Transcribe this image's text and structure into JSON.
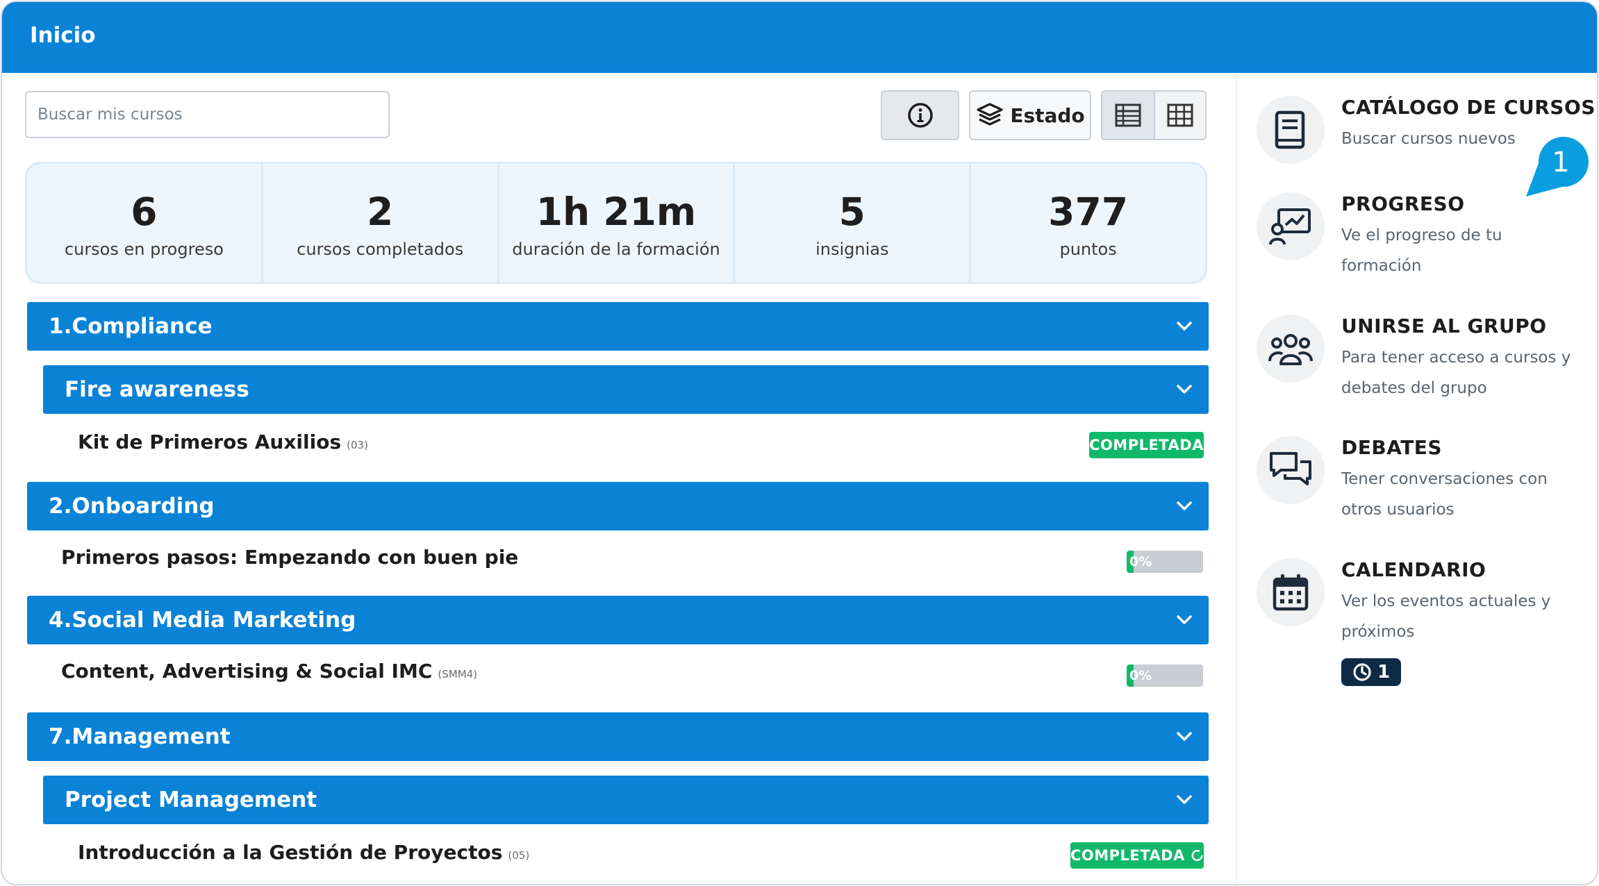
{
  "header": {
    "title": "Inicio"
  },
  "search": {
    "placeholder": "Buscar mis cursos"
  },
  "toolbar": {
    "info_icon": "info-circle-icon",
    "estado_label": "Estado",
    "estado_icon": "layers-icon",
    "view_list_icon": "table-list-icon",
    "view_grid_icon": "grid-icon"
  },
  "stats": [
    {
      "value": "6",
      "label": "cursos en progreso"
    },
    {
      "value": "2",
      "label": "cursos completados"
    },
    {
      "value": "1h 21m",
      "label": "duración de la formación"
    },
    {
      "value": "5",
      "label": "insignias"
    },
    {
      "value": "377",
      "label": "puntos"
    }
  ],
  "categories": [
    {
      "title": "1.Compliance",
      "subcategory": "Fire awareness",
      "course": {
        "name": "Kit de Primeros Auxilios",
        "code": "(03)",
        "status": "COMPLETADA"
      }
    },
    {
      "title": "2.Onboarding",
      "course": {
        "name": "Primeros pasos: Empezando con buen pie",
        "progress": 0,
        "progress_label": "0%"
      }
    },
    {
      "title": "4.Social Media Marketing",
      "course": {
        "name": "Content, Advertising & Social IMC",
        "code": "(SMM4)",
        "progress": 0,
        "progress_label": "0%"
      }
    },
    {
      "title": "7.Management",
      "subcategory": "Project Management",
      "course": {
        "name": "Introducción a la Gestión de Proyectos",
        "code": "(05)",
        "status": "COMPLETADA",
        "status_icon": "refresh-circle-icon"
      }
    }
  ],
  "sidebar": {
    "items": [
      {
        "title": "CATÁLOGO DE CURSOS",
        "desc": "Buscar cursos nuevos",
        "icon": "book-icon"
      },
      {
        "title": "PROGRESO",
        "desc": "Ve el progreso de tu formación",
        "icon": "progress-chart-icon"
      },
      {
        "title": "UNIRSE AL GRUPO",
        "desc": "Para tener acceso a cursos y debates del grupo",
        "icon": "group-icon"
      },
      {
        "title": "DEBATES",
        "desc": "Tener conversaciones con otros usuarios",
        "icon": "chat-icon"
      },
      {
        "title": "CALENDARIO",
        "desc": "Ver los eventos actuales y próximos",
        "icon": "calendar-icon",
        "events_count": "1"
      }
    ]
  },
  "callout": {
    "number": "1"
  },
  "colors": {
    "primary": "#0a82d6",
    "success": "#10b96a",
    "dark": "#0f2a44"
  }
}
